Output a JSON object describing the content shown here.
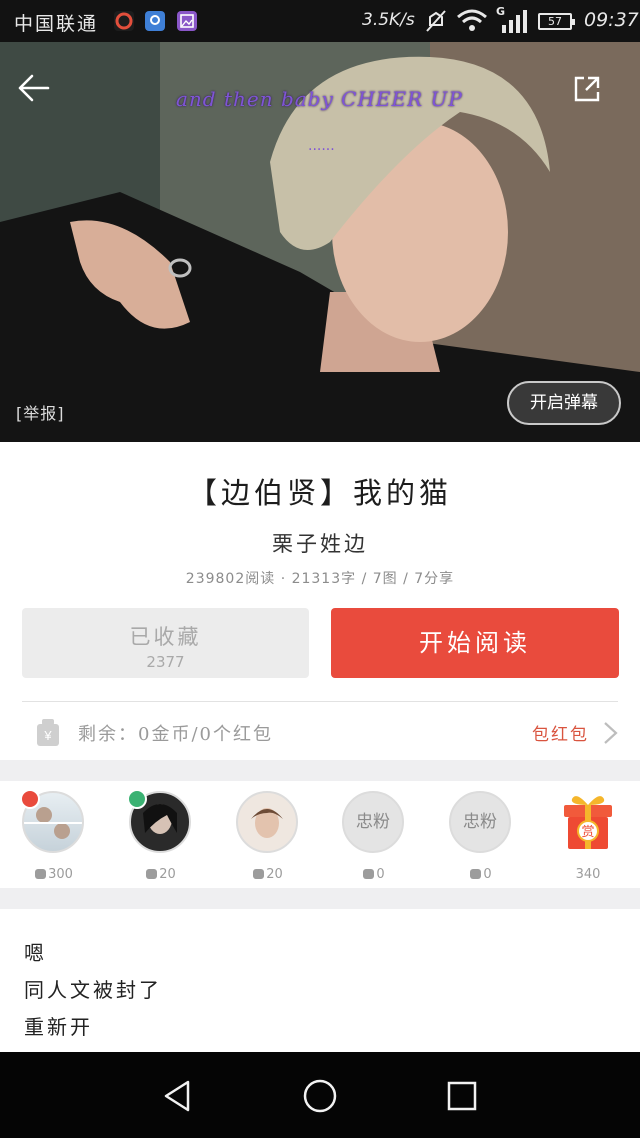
{
  "status_bar": {
    "carrier": "中国联通",
    "net_speed": "3.5K/s",
    "signal_label": "G",
    "battery": "57",
    "time": "09:37"
  },
  "hero": {
    "caption": "and then baby CHEER UP",
    "caption_dots": "......",
    "report_label": "[举报]",
    "danmaku_label": "开启弹幕"
  },
  "book": {
    "title": "【边伯贤】我的猫",
    "author": "栗子姓边",
    "stats": "239802阅读 · 21313字 / 7图 / 7分享"
  },
  "actions": {
    "collect_label": "已收藏",
    "collect_count": "2377",
    "read_label": "开始阅读"
  },
  "wallet": {
    "remain_text": "剩余：0金币/0个红包",
    "red_packet_label": "包红包"
  },
  "fans": [
    {
      "coins": "300",
      "placeholder": "",
      "badge_color": "#e94b3d"
    },
    {
      "coins": "20",
      "placeholder": "",
      "badge_color": "#3bb273"
    },
    {
      "coins": "20",
      "placeholder": "",
      "badge_color": ""
    },
    {
      "coins": "0",
      "placeholder": "忠粉",
      "badge_color": ""
    },
    {
      "coins": "0",
      "placeholder": "忠粉",
      "badge_color": ""
    }
  ],
  "gift": {
    "coins": "340",
    "label": "赏"
  },
  "content_lines": [
    "嗯",
    "同人文被封了",
    "重新开"
  ],
  "colors": {
    "accent": "#e94b3d",
    "caption": "#7f54d6"
  }
}
